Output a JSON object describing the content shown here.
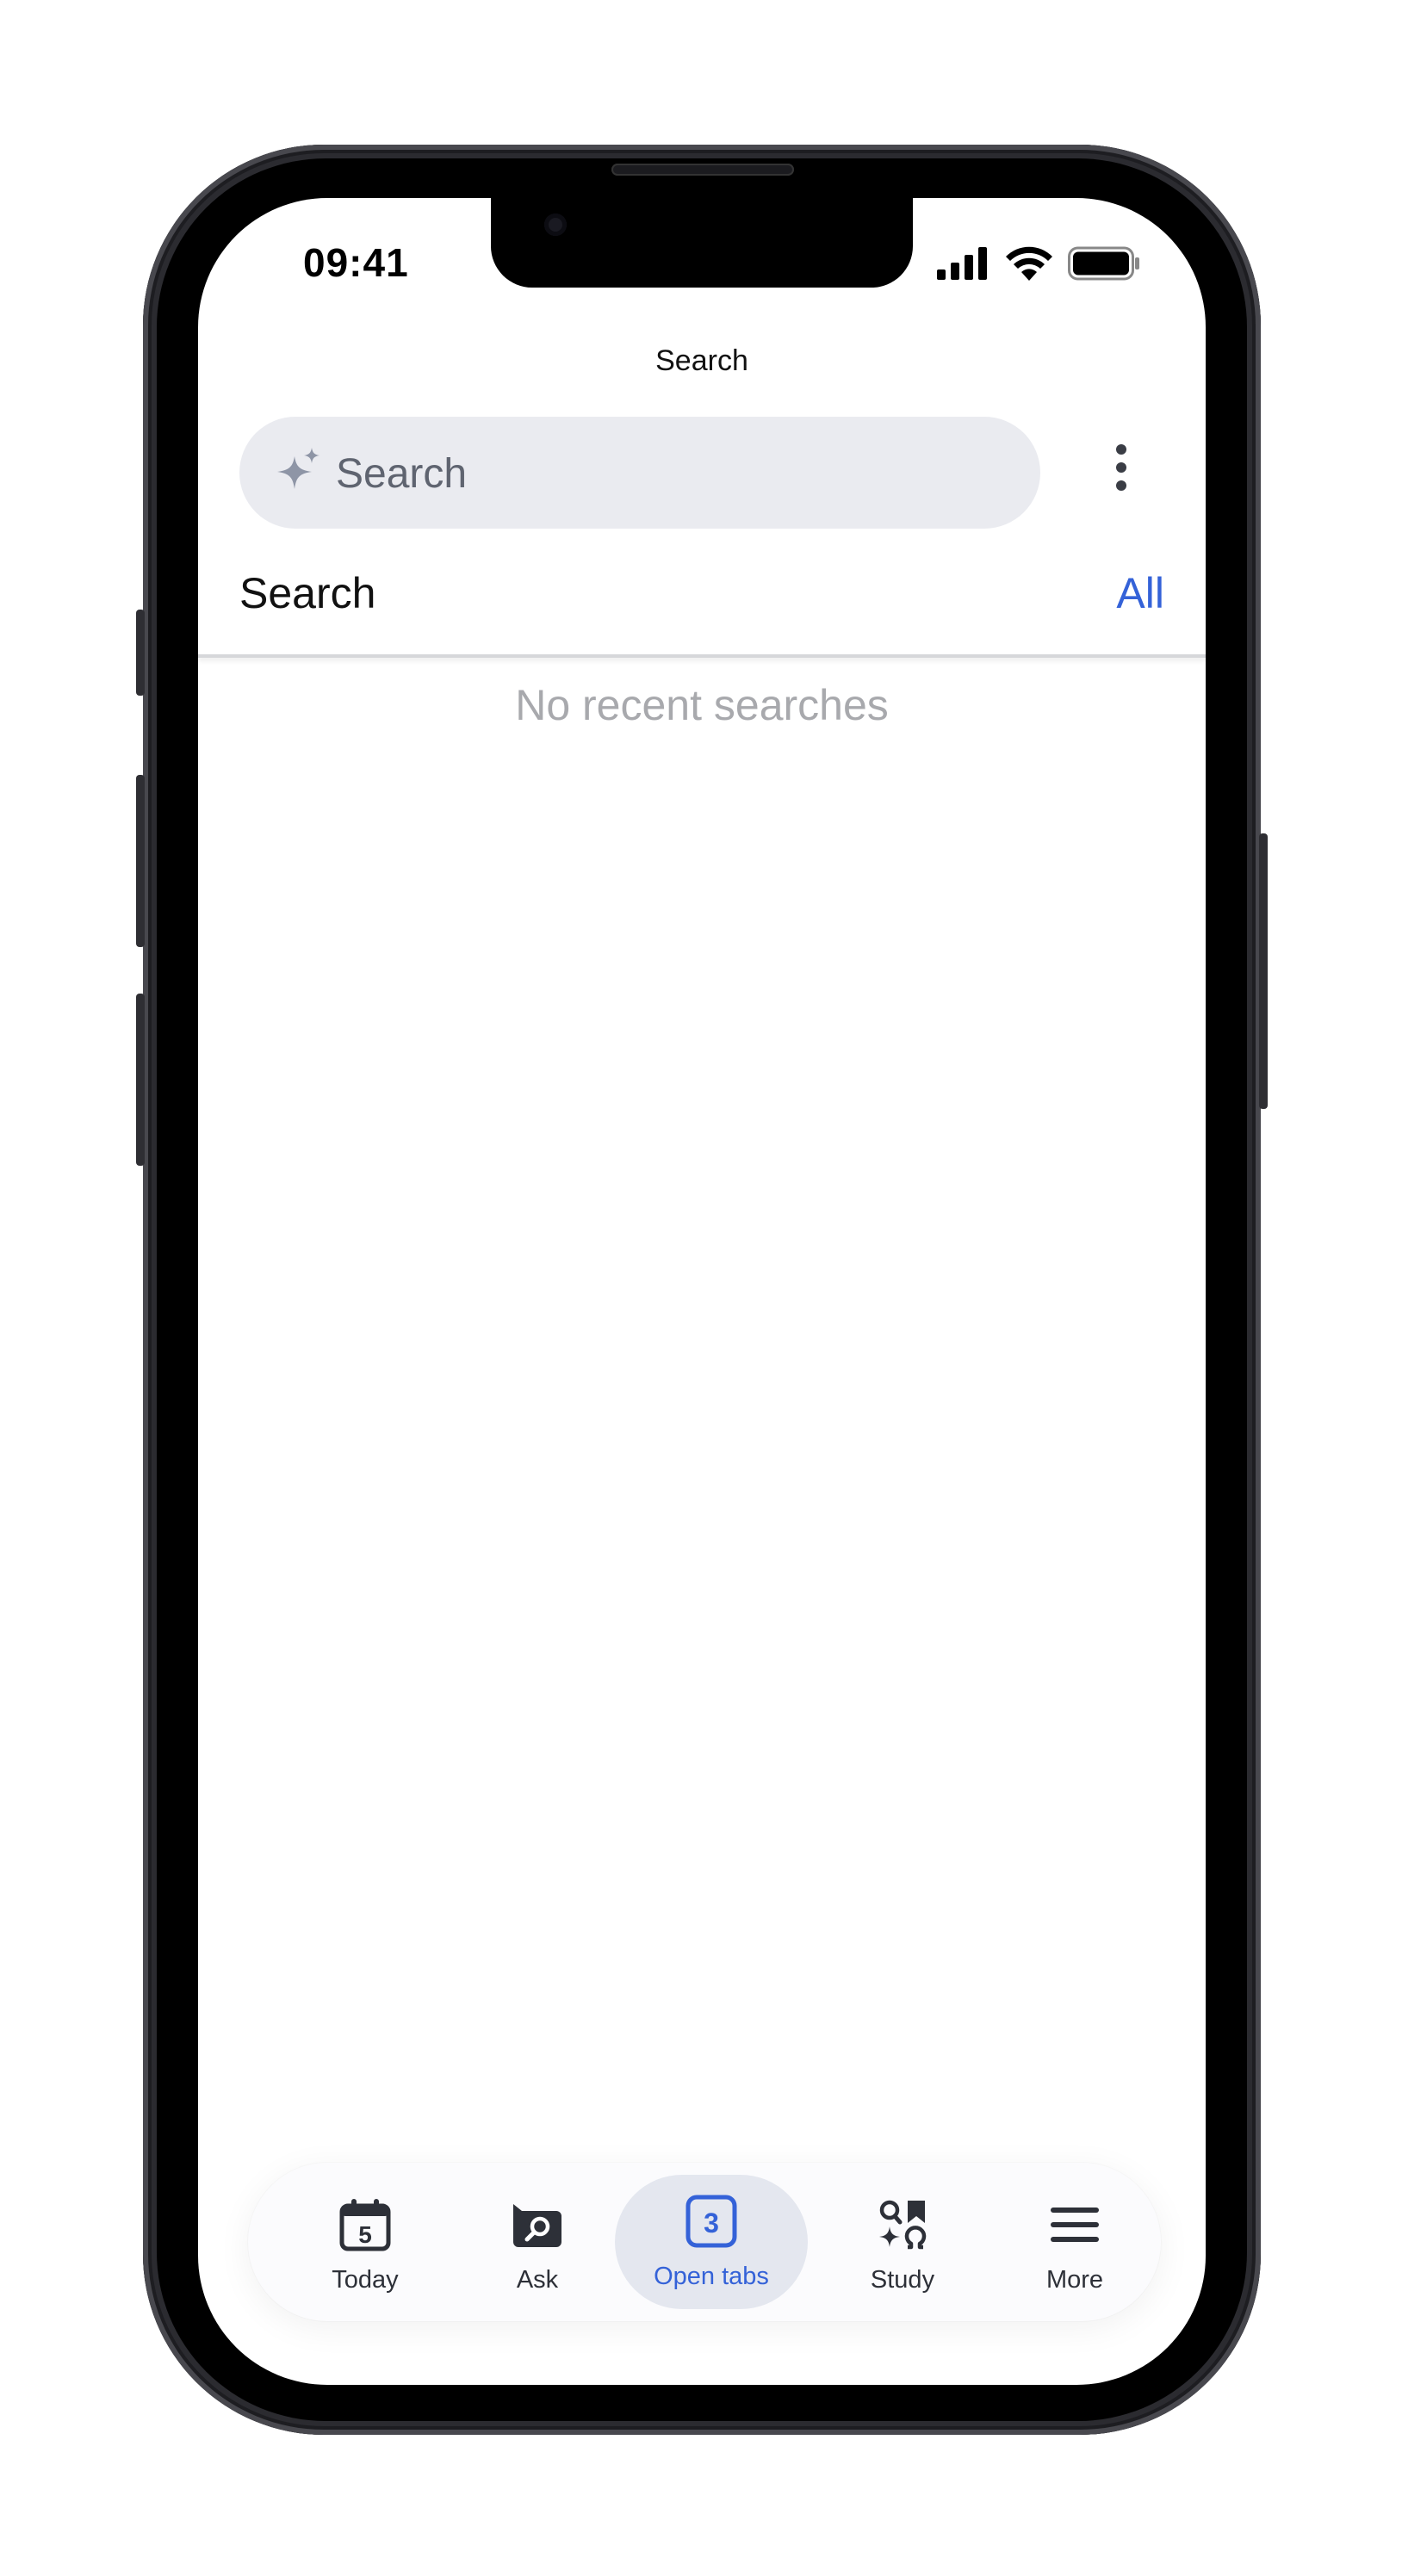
{
  "status_bar": {
    "time": "09:41"
  },
  "header": {
    "title": "Search"
  },
  "search": {
    "placeholder": "Search",
    "value": ""
  },
  "section": {
    "title": "Search",
    "action_label": "All"
  },
  "empty_state": {
    "text": "No recent searches"
  },
  "bottom_nav": {
    "items": [
      {
        "label": "Today",
        "icon": "calendar-icon",
        "badge": "5"
      },
      {
        "label": "Ask",
        "icon": "chat-search-icon"
      },
      {
        "label": "Open tabs",
        "icon": "tabs-icon",
        "badge": "3",
        "active": true
      },
      {
        "label": "Study",
        "icon": "study-icon"
      },
      {
        "label": "More",
        "icon": "menu-icon"
      }
    ]
  },
  "colors": {
    "accent": "#3462d8",
    "search_bg": "#eaebf0",
    "muted_text": "#a8a9ad"
  }
}
